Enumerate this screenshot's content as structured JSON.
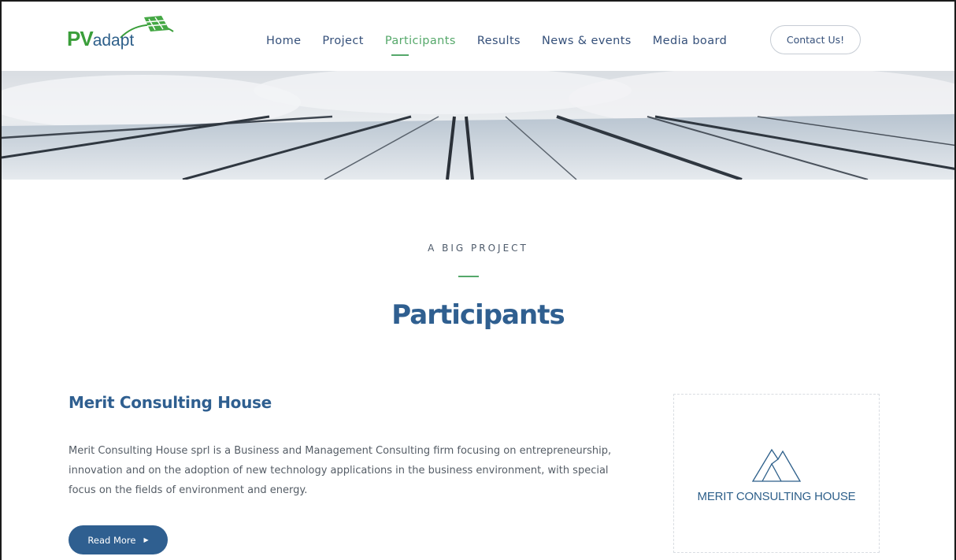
{
  "logo": {
    "pv": "PV",
    "adapt": "adapt"
  },
  "nav": {
    "items": [
      {
        "label": "Home"
      },
      {
        "label": "Project"
      },
      {
        "label": "Participants"
      },
      {
        "label": "Results"
      },
      {
        "label": "News & events"
      },
      {
        "label": "Media board"
      }
    ],
    "active_index": 2,
    "contact_label": "Contact Us!"
  },
  "colors": {
    "accent_green": "#55a86a",
    "brand_blue": "#2f5f90",
    "nav_text": "#35507a"
  },
  "section": {
    "kicker": "A BIG PROJECT",
    "title": "Participants"
  },
  "participant": {
    "name": "Merit Consulting House",
    "description": "Merit Consulting House sprl is a Business and Management Consulting firm focusing on entrepreneurship, innovation and on the adoption of new technology applications in the business environment, with special focus on the fields of environment and energy.",
    "read_more_label": "Read More",
    "logo_text": "MERIT CONSULTING HOUSE"
  },
  "icons": {
    "logo_mark": "solar-panel-arc-icon",
    "read_more_arrow": "caret-right-icon",
    "participant_logo": "mountain-triangle-icon"
  }
}
